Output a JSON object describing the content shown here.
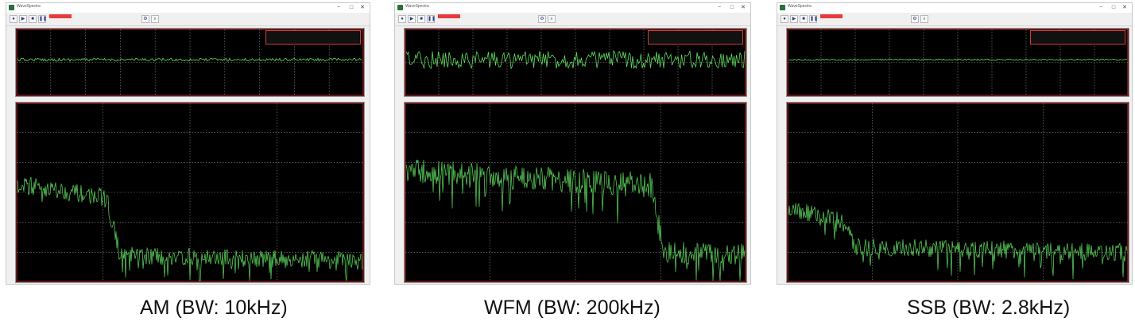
{
  "captions": [
    "AM (BW: 10kHz)",
    "WFM (BW: 200kHz)",
    "SSB (BW: 2.8kHz)"
  ],
  "window": {
    "title": "WaveSpectra",
    "controls": {
      "minimize": "−",
      "maximize": "□",
      "close": "✕"
    }
  },
  "icons": {
    "app": "app-icon",
    "record": "record-icon",
    "stop": "stop-icon",
    "pause": "pause-icon",
    "play": "play-icon",
    "settings": "gear-icon"
  },
  "colors": {
    "plot_background": "#000000",
    "trace": "#5fdc5f",
    "grid": "#8a8a8a",
    "frame": "#c83232",
    "toolbar_accent": "#e63b3b"
  },
  "panels": [
    {
      "mode": "AM",
      "waveform_amplitude": 0.02,
      "spectrum": {
        "start_level": 0.55,
        "knee": 0.26,
        "floor_level": 0.15,
        "noise": 0.05
      }
    },
    {
      "mode": "WFM",
      "waveform_amplitude": 0.12,
      "spectrum": {
        "start_level": 0.62,
        "knee": 0.72,
        "floor_level": 0.17,
        "noise": 0.07
      }
    },
    {
      "mode": "SSB",
      "waveform_amplitude": 0.01,
      "spectrum": {
        "start_level": 0.42,
        "knee": 0.16,
        "floor_level": 0.2,
        "noise": 0.05
      }
    }
  ]
}
